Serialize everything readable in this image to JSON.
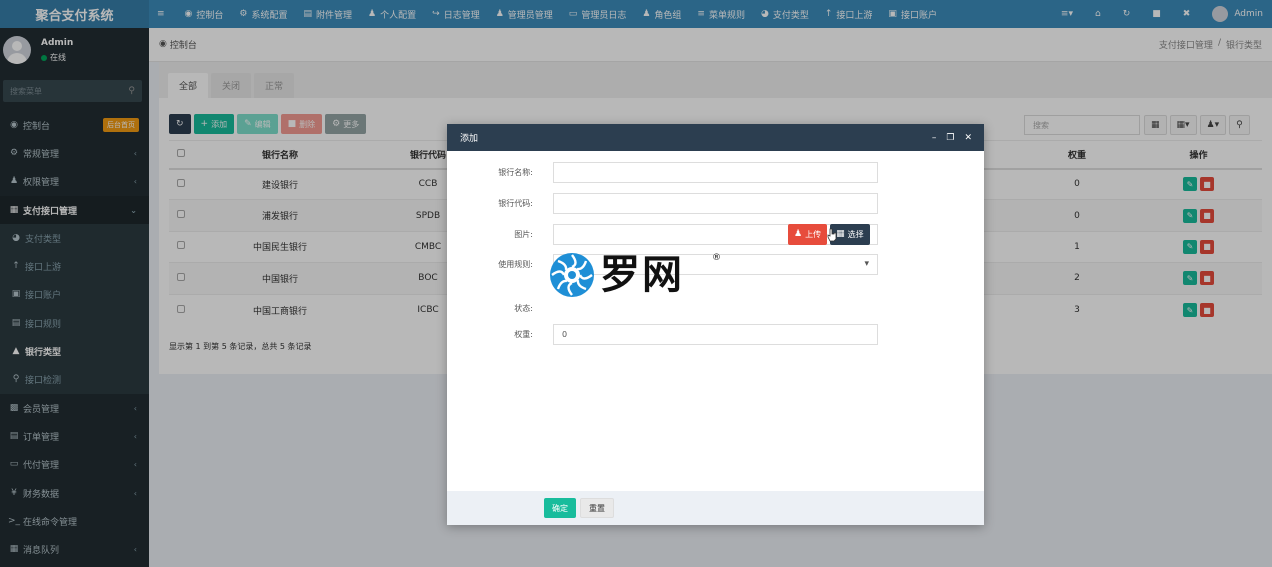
{
  "app": {
    "title": "聚合支付系统"
  },
  "user": {
    "name": "Admin",
    "status": "在线"
  },
  "sidebar": {
    "search_placeholder": "搜索菜单",
    "items": [
      {
        "label": "控制台",
        "icon": "dashboard-icon",
        "badge": "后台首页"
      },
      {
        "label": "常规管理",
        "icon": "cogs-icon",
        "arrow": "‹"
      },
      {
        "label": "权限管理",
        "icon": "users-icon",
        "arrow": "‹"
      },
      {
        "label": "支付接口管理",
        "icon": "list-icon",
        "arrow": "⌄"
      },
      {
        "label": "支付类型",
        "icon": "pie-icon"
      },
      {
        "label": "接口上游",
        "icon": "arrow-up-icon"
      },
      {
        "label": "接口账户",
        "icon": "square-icon"
      },
      {
        "label": "接口规则",
        "icon": "rule-icon"
      },
      {
        "label": "银行类型",
        "icon": "bank-icon"
      },
      {
        "label": "接口检测",
        "icon": "search-icon"
      },
      {
        "label": "会员管理",
        "icon": "member-icon",
        "arrow": "‹"
      },
      {
        "label": "订单管理",
        "icon": "order-icon",
        "arrow": "‹"
      },
      {
        "label": "代付管理",
        "icon": "card-icon",
        "arrow": "‹"
      },
      {
        "label": "财务数据",
        "icon": "yen-icon",
        "arrow": "‹"
      },
      {
        "label": "在线命令管理",
        "icon": "terminal-icon"
      },
      {
        "label": "消息队列",
        "icon": "queue-icon",
        "arrow": "‹"
      }
    ]
  },
  "topnav": {
    "items": [
      {
        "label": "控制台",
        "icon": "dashboard-icon"
      },
      {
        "label": "系统配置",
        "icon": "gear-icon"
      },
      {
        "label": "附件管理",
        "icon": "file-icon"
      },
      {
        "label": "个人配置",
        "icon": "user-icon"
      },
      {
        "label": "日志管理",
        "icon": "log-icon"
      },
      {
        "label": "管理员管理",
        "icon": "user-icon"
      },
      {
        "label": "管理员日志",
        "icon": "list-icon"
      },
      {
        "label": "角色组",
        "icon": "group-icon"
      },
      {
        "label": "菜单规则",
        "icon": "bars-icon"
      },
      {
        "label": "支付类型",
        "icon": "pie-icon"
      },
      {
        "label": "接口上游",
        "icon": "arrow-up-icon"
      },
      {
        "label": "接口账户",
        "icon": "square-icon"
      }
    ],
    "user": "Admin"
  },
  "breadcrumb": {
    "home": "控制台",
    "path": [
      "支付接口管理",
      "/",
      "银行类型"
    ]
  },
  "tabs": [
    "全部",
    "关闭",
    "正常"
  ],
  "toolbar": {
    "add": "添加",
    "edit": "编辑",
    "delete": "删除",
    "more": "更多"
  },
  "table": {
    "search_placeholder": "搜索",
    "columns": [
      "银行名称",
      "银行代码",
      "权重",
      "操作"
    ],
    "rows": [
      {
        "name": "建设银行",
        "code": "CCB",
        "weight": "0"
      },
      {
        "name": "浦发银行",
        "code": "SPDB",
        "weight": "0"
      },
      {
        "name": "中国民生银行",
        "code": "CMBC",
        "weight": "1"
      },
      {
        "name": "中国银行",
        "code": "BOC",
        "weight": "2"
      },
      {
        "name": "中国工商银行",
        "code": "ICBC",
        "weight": "3"
      }
    ],
    "footer": "显示第 1 到第 5 条记录，总共 5 条记录"
  },
  "modal": {
    "title": "添加",
    "fields": {
      "name_label": "银行名称:",
      "code_label": "银行代码:",
      "image_label": "图片:",
      "upload": "上传",
      "choose": "选择",
      "rule_label": "使用规则:",
      "status_label": "状态:",
      "weight_label": "权重:",
      "weight_value": "0"
    },
    "ok": "确定",
    "reset": "重置"
  },
  "watermark": {
    "text": "罗网",
    "reg": "®"
  }
}
